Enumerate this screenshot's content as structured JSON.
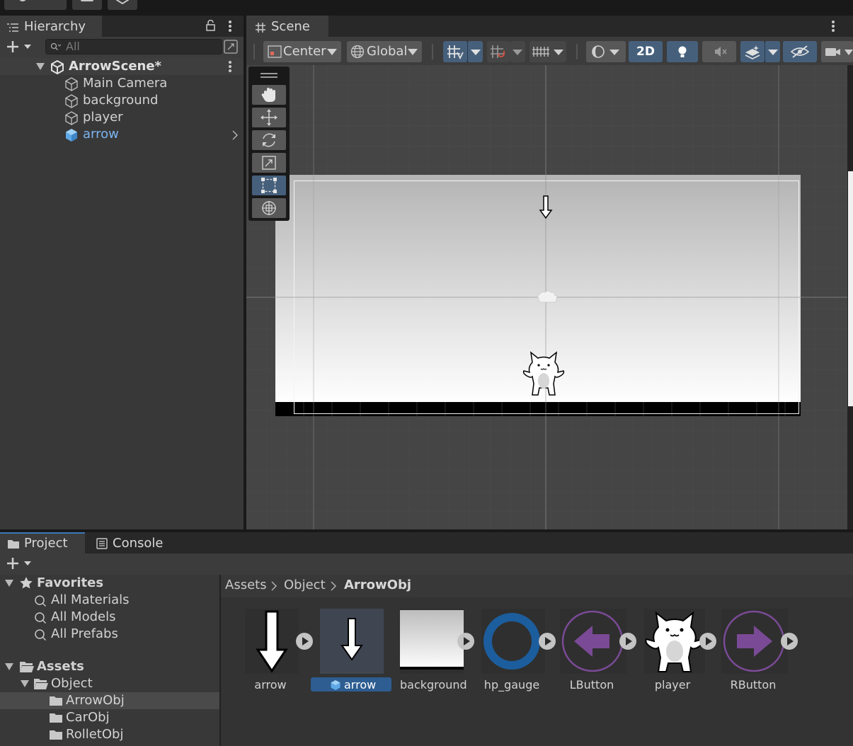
{
  "hierarchy": {
    "tab_label": "Hierarchy",
    "search_placeholder": "All",
    "scene_name": "ArrowScene*",
    "items": [
      {
        "label": "Main Camera"
      },
      {
        "label": "background"
      },
      {
        "label": "player"
      },
      {
        "label": "arrow"
      }
    ]
  },
  "scene": {
    "tab_label": "Scene",
    "pivot_label": "Center",
    "space_label": "Global",
    "mode_2d_label": "2D",
    "tools": [
      "hand-tool",
      "move-tool",
      "rotate-tool",
      "scale-tool",
      "rect-tool",
      "transform-tool"
    ],
    "active_tool": "rect-tool"
  },
  "bottom": {
    "tabs": [
      {
        "label": "Project"
      },
      {
        "label": "Console"
      }
    ],
    "favorites": {
      "label": "Favorites",
      "items": [
        {
          "label": "All Materials"
        },
        {
          "label": "All Models"
        },
        {
          "label": "All Prefabs"
        }
      ]
    },
    "assets_root": "Assets",
    "folders": [
      {
        "label": "Object"
      },
      {
        "label": "ArrowObj"
      },
      {
        "label": "CarObj"
      },
      {
        "label": "RolletObj"
      }
    ],
    "breadcrumb": [
      {
        "label": "Assets"
      },
      {
        "label": "Object"
      },
      {
        "label": "ArrowObj"
      }
    ],
    "assets": [
      {
        "label": "arrow"
      },
      {
        "label": "arrow"
      },
      {
        "label": "background"
      },
      {
        "label": "hp_gauge"
      },
      {
        "label": "LButton"
      },
      {
        "label": "player"
      },
      {
        "label": "RButton"
      }
    ]
  },
  "colors": {
    "accent": "#4c7cb8",
    "selected_text": "#7cb4f0",
    "panel": "#383838",
    "scene_bg": "#454545"
  }
}
